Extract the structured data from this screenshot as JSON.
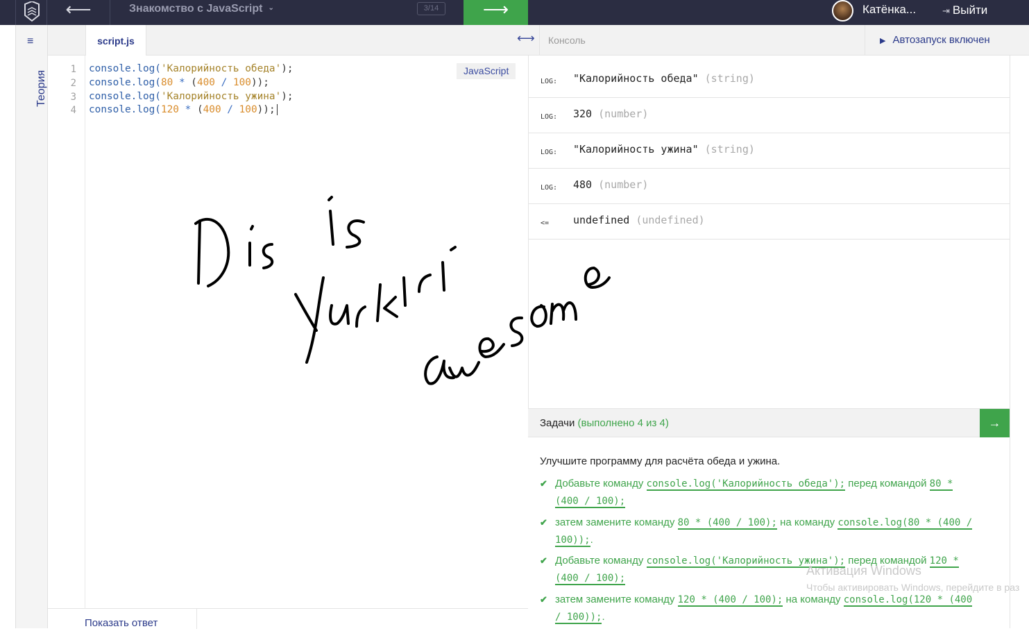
{
  "topbar": {
    "back_arrow": "⟵",
    "course_title": "Знакомство с JavaScript",
    "title_chevron": "⌄",
    "page_counter": "3/14",
    "next_arrow": "⟶",
    "user_name": "Катёнка...",
    "logout_label": "Выйти"
  },
  "rail": {
    "menu_icon": "≡",
    "theory_label": "Теория"
  },
  "editor": {
    "tab_label": "script.js",
    "language": "JavaScript",
    "show_answer": "Показать ответ",
    "lines": [
      {
        "num": "1",
        "fn": "console.",
        "call": "log(",
        "str": "'Калорийность обеда'",
        "tail": ");"
      },
      {
        "num": "2",
        "fn": "console.",
        "call": "log(",
        "a": "80",
        "op1": " * ",
        "p": "(",
        "b": "400",
        "op2": " / ",
        "c": "100",
        "tail": "));"
      },
      {
        "num": "3",
        "fn": "console.",
        "call": "log(",
        "str": "'Калорийность ужина'",
        "tail": ");"
      },
      {
        "num": "4",
        "fn": "console.",
        "call": "log(",
        "a": "120",
        "op1": " * ",
        "p": "(",
        "b": "400",
        "op2": " / ",
        "c": "100",
        "tail": "));"
      }
    ]
  },
  "console": {
    "title": "Консоль",
    "autorun": "Автозапуск включен",
    "resize_icon": "⟷",
    "rows": [
      {
        "kind": "LOG:",
        "value": "\"Калорийность обеда\"",
        "type": "(string)"
      },
      {
        "kind": "LOG:",
        "value": "320",
        "type": "(number)"
      },
      {
        "kind": "LOG:",
        "value": "\"Калорийность ужина\"",
        "type": "(string)"
      },
      {
        "kind": "LOG:",
        "value": "480",
        "type": "(number)"
      },
      {
        "kind": "<=",
        "value": "undefined",
        "type": "(undefined)"
      }
    ]
  },
  "tasks": {
    "title": "Задачи",
    "progress": "(выполнено 4 из 4)",
    "next_arrow": "→",
    "intro": "Улучшите программу для расчёта обеда и ужина.",
    "items": [
      {
        "pre": "Добавьте команду ",
        "code1": "console.log('Калорийность обеда');",
        "mid": " перед командой ",
        "code2": "80 * (400 / 100);",
        "post": ""
      },
      {
        "pre": "затем замените команду ",
        "code1": "80 * (400 / 100);",
        "mid": " на команду ",
        "code2": "console.log(80 * (400 / 100));",
        "post": "."
      },
      {
        "pre": "Добавьте команду ",
        "code1": "console.log('Калорийность ужина');",
        "mid": " перед командой ",
        "code2": "120 * (400 / 100);",
        "post": ""
      },
      {
        "pre": "затем замените команду ",
        "code1": "120 * (400 / 100);",
        "mid": " на команду ",
        "code2": "console.log(120 * (400 / 100));",
        "post": "."
      }
    ]
  },
  "watermark": {
    "line1": "Активация Windows",
    "line2": "Чтобы активировать Windows, перейдите в раз"
  },
  "handwriting": {
    "line1": "Dis is",
    "line2": "Yurkiri",
    "line3": "awesome",
    "color": "#000000"
  },
  "colors": {
    "topbar": "#2b2d42",
    "accent_green": "#3fa44b",
    "link_blue": "#2b3a8a"
  }
}
